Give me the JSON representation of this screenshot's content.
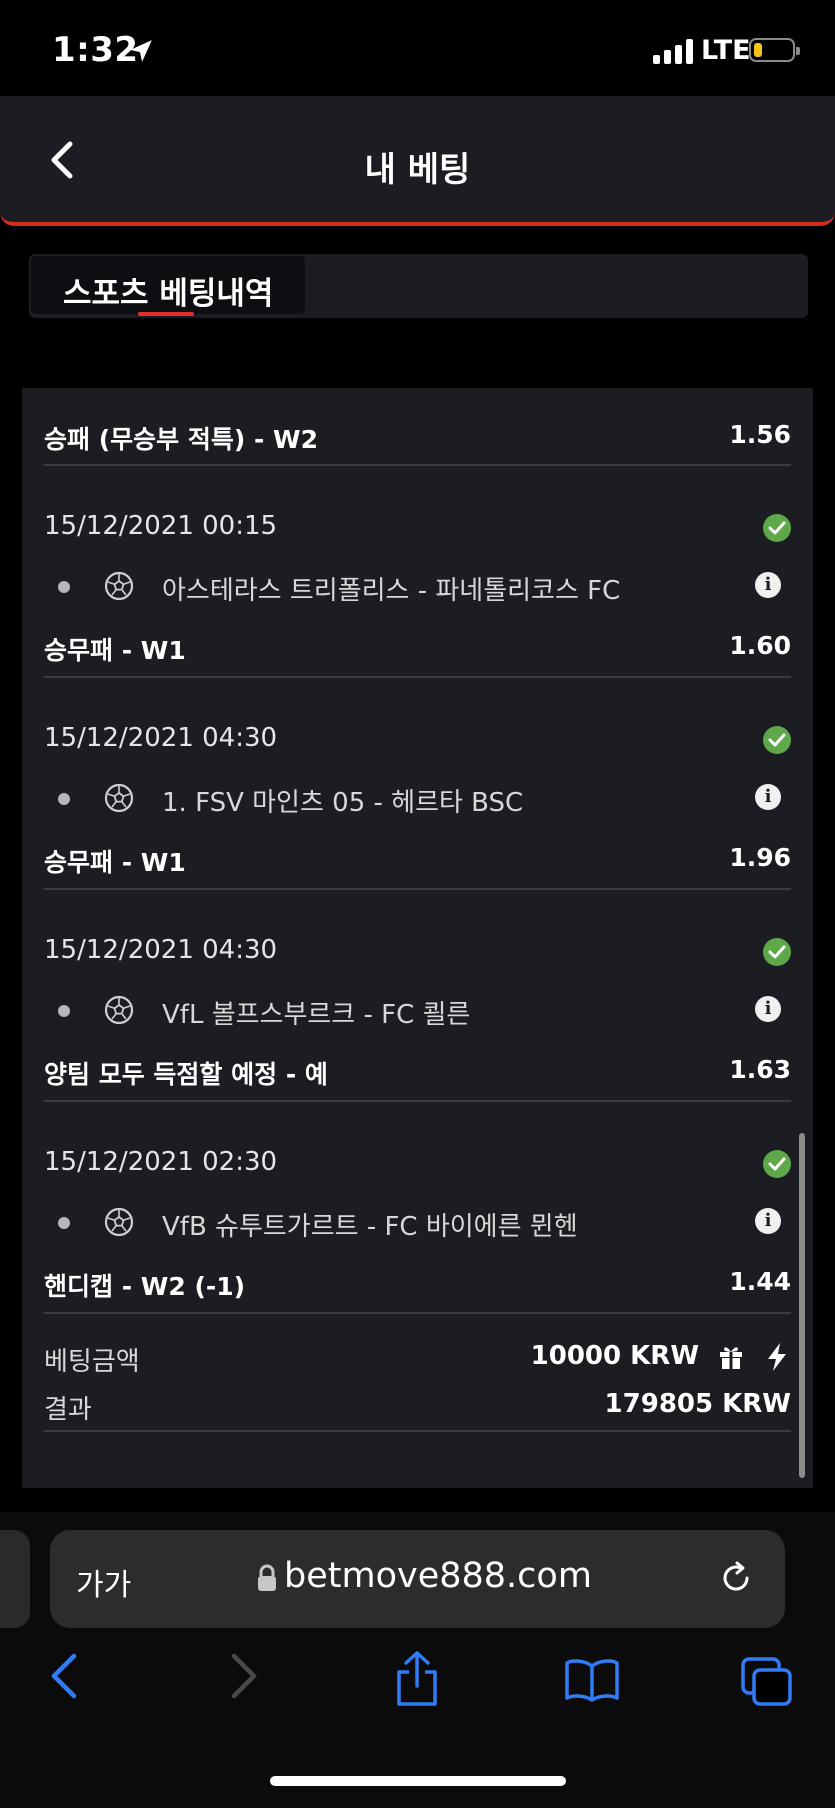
{
  "status_bar": {
    "time": "1:32",
    "network": "LTE"
  },
  "header": {
    "title": "내 베팅"
  },
  "tabs": [
    {
      "label": "스포츠 베팅내역"
    }
  ],
  "bets": {
    "top_market": "승패 (무승부 적특) - W2",
    "top_odds": "1.56",
    "items": [
      {
        "datetime": "15/12/2021 00:15",
        "match": "아스테라스 트리폴리스 - 파네톨리코스 FC",
        "market": "승무패 - W1",
        "odds": "1.60"
      },
      {
        "datetime": "15/12/2021 04:30",
        "match": "1. FSV 마인츠 05 - 헤르타 BSC",
        "market": "승무패 - W1",
        "odds": "1.96"
      },
      {
        "datetime": "15/12/2021 04:30",
        "match": "VfL 볼프스부르크 - FC 쾰른",
        "market": "양팀 모두 득점할 예정 - 예",
        "odds": "1.63"
      },
      {
        "datetime": "15/12/2021 02:30",
        "match": "VfB 슈투트가르트 - FC 바이에른 뮌헨",
        "market": "핸디캡 - W2 (-1)",
        "odds": "1.44"
      }
    ],
    "summary": {
      "stake_label": "베팅금액",
      "stake_value": "10000 KRW",
      "result_label": "결과",
      "result_value": "179805 KRW"
    }
  },
  "browser": {
    "text_size_label": "가가",
    "url": "betmove888.com"
  },
  "colors": {
    "accent": "#d42b1f",
    "success": "#5fa84a",
    "panel": "#1b1d22",
    "ios_blue": "#2f7cf6"
  }
}
